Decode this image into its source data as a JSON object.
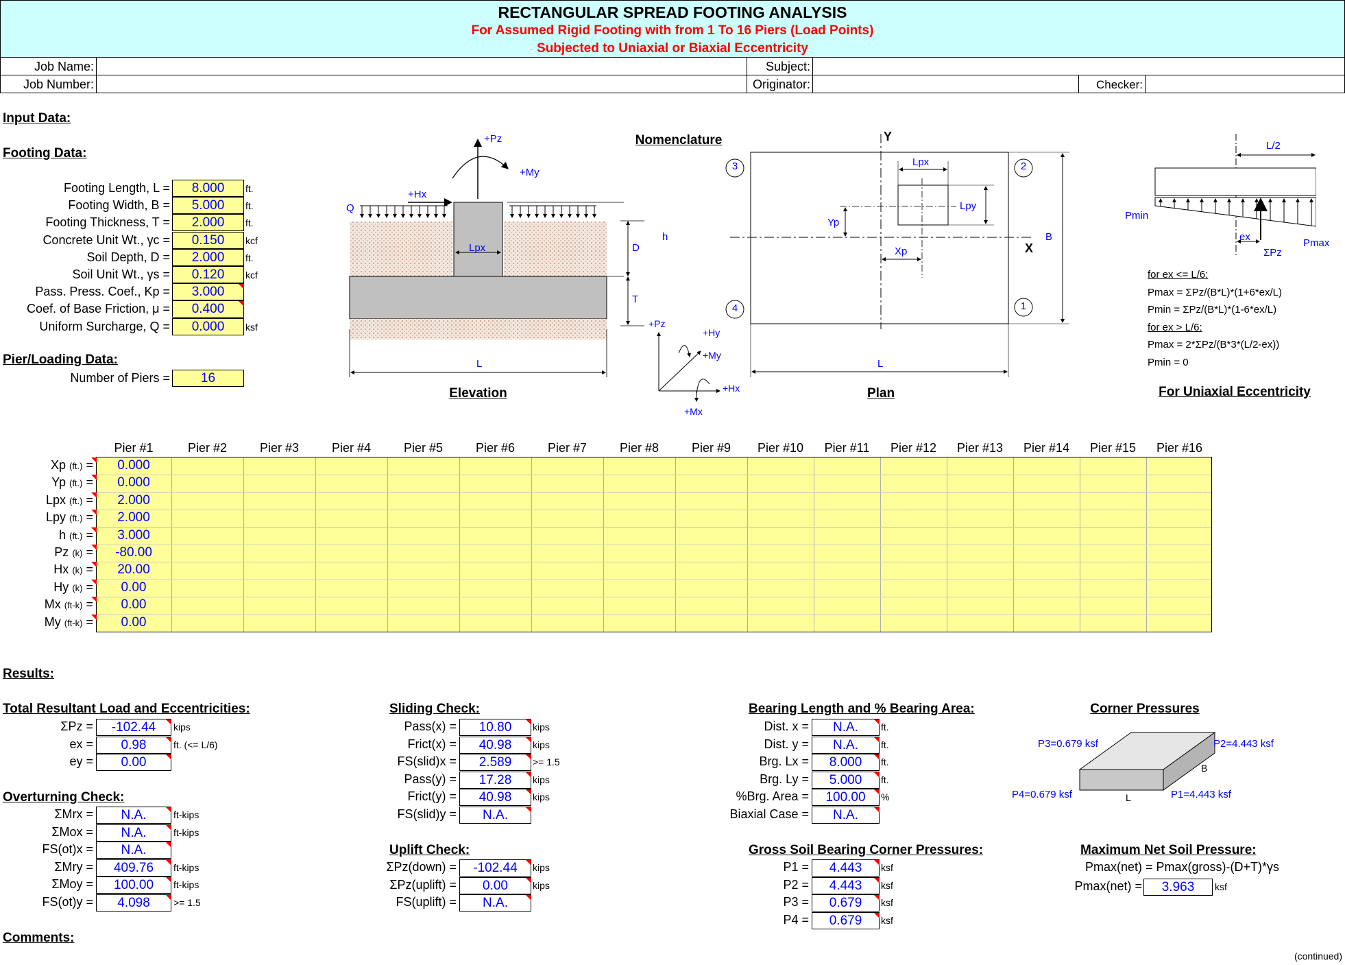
{
  "header": {
    "title": "RECTANGULAR SPREAD FOOTING ANALYSIS",
    "subtitle1": "For Assumed Rigid Footing with from 1 To 16 Piers (Load Points)",
    "subtitle2": "Subjected to Uniaxial or Biaxial Eccentricity"
  },
  "job": {
    "job_name_label": "Job Name:",
    "job_number_label": "Job Number:",
    "subject_label": "Subject:",
    "originator_label": "Originator:",
    "checker_label": "Checker:"
  },
  "input": {
    "section": "Input Data:",
    "footing_section": "Footing Data:",
    "footing": [
      {
        "label": "Footing Length, L =",
        "value": "8.000",
        "unit": "ft."
      },
      {
        "label": "Footing Width, B =",
        "value": "5.000",
        "unit": "ft."
      },
      {
        "label": "Footing Thickness, T =",
        "value": "2.000",
        "unit": "ft."
      },
      {
        "label": "Concrete Unit Wt., γc =",
        "value": "0.150",
        "unit": "kcf"
      },
      {
        "label": "Soil Depth, D =",
        "value": "2.000",
        "unit": "ft."
      },
      {
        "label": "Soil Unit Wt., γs =",
        "value": "0.120",
        "unit": "kcf"
      },
      {
        "label": "Pass. Press. Coef., Kp =",
        "value": "3.000",
        "unit": ""
      },
      {
        "label": "Coef. of Base Friction, μ =",
        "value": "0.400",
        "unit": ""
      },
      {
        "label": "Uniform Surcharge, Q =",
        "value": "0.000",
        "unit": "ksf"
      }
    ],
    "pier_section": "Pier/Loading Data:",
    "num_piers_label": "Number of Piers =",
    "num_piers": "16"
  },
  "diagrams": {
    "nomenclature": "Nomenclature",
    "elevation": "Elevation",
    "plan": "Plan",
    "uniaxial": "For Uniaxial Eccentricity",
    "elev_labels": {
      "pz": "+Pz",
      "my": "+My",
      "hx": "+Hx",
      "q": "Q",
      "lpx": "Lpx",
      "d": "D",
      "h": "h",
      "t": "T",
      "l": "L"
    },
    "axes_labels": {
      "pz": "+Pz",
      "hy": "+Hy",
      "my": "+My",
      "hx": "+Hx",
      "mx": "+Mx"
    },
    "plan_labels": {
      "y": "Y",
      "x": "X",
      "lpx": "Lpx",
      "lpy": "Lpy",
      "yp": "Yp",
      "xp": "Xp",
      "b": "B",
      "l": "L",
      "c1": "1",
      "c2": "2",
      "c3": "3",
      "c4": "4"
    },
    "ecc_labels": {
      "l2": "L/2",
      "pmin": "Pmin",
      "pmax": "Pmax",
      "ex": "ex",
      "spz": "ΣPz"
    },
    "formulas": [
      "for ex <= L/6:",
      "Pmax = ΣPz/(B*L)*(1+6*ex/L)",
      "Pmin = ΣPz/(B*L)*(1-6*ex/L)",
      "for ex > L/6:",
      "Pmax = 2*ΣPz/(B*3*(L/2-ex))",
      "Pmin = 0"
    ]
  },
  "piers": {
    "headers": [
      "Pier #1",
      "Pier #2",
      "Pier #3",
      "Pier #4",
      "Pier #5",
      "Pier #6",
      "Pier #7",
      "Pier #8",
      "Pier #9",
      "Pier #10",
      "Pier #11",
      "Pier #12",
      "Pier #13",
      "Pier #14",
      "Pier #15",
      "Pier #16"
    ],
    "rows": [
      {
        "label": "Xp",
        "unit": "(ft.)",
        "value": "0.000"
      },
      {
        "label": "Yp",
        "unit": "(ft.)",
        "value": "0.000"
      },
      {
        "label": "Lpx",
        "unit": "(ft.)",
        "value": "2.000"
      },
      {
        "label": "Lpy",
        "unit": "(ft.)",
        "value": "2.000"
      },
      {
        "label": "h",
        "unit": "(ft.)",
        "value": "3.000"
      },
      {
        "label": "Pz",
        "unit": "(k)",
        "value": "-80.00"
      },
      {
        "label": "Hx",
        "unit": "(k)",
        "value": "20.00"
      },
      {
        "label": "Hy",
        "unit": "(k)",
        "value": "0.00"
      },
      {
        "label": "Mx",
        "unit": "(ft-k)",
        "value": "0.00"
      },
      {
        "label": "My",
        "unit": "(ft-k)",
        "value": "0.00"
      }
    ]
  },
  "results": {
    "section": "Results:",
    "resultant": {
      "title": "Total Resultant Load and Eccentricities:",
      "rows": [
        {
          "label": "ΣPz =",
          "value": "-102.44",
          "unit": "kips"
        },
        {
          "label": "ex =",
          "value": "0.98",
          "unit": "ft. (<= L/6)"
        },
        {
          "label": "ey =",
          "value": "0.00",
          "unit": ""
        }
      ]
    },
    "overturning": {
      "title": "Overturning Check:",
      "rows": [
        {
          "label": "ΣMrx =",
          "value": "N.A.",
          "unit": "ft-kips"
        },
        {
          "label": "ΣMox =",
          "value": "N.A.",
          "unit": "ft-kips"
        },
        {
          "label": "FS(ot)x =",
          "value": "N.A.",
          "unit": ""
        },
        {
          "label": "ΣMry =",
          "value": "409.76",
          "unit": "ft-kips"
        },
        {
          "label": "ΣMoy =",
          "value": "100.00",
          "unit": "ft-kips"
        },
        {
          "label": "FS(ot)y =",
          "value": "4.098",
          "unit": ">= 1.5"
        }
      ]
    },
    "sliding": {
      "title": "Sliding Check:",
      "rows": [
        {
          "label": "Pass(x) =",
          "value": "10.80",
          "unit": "kips"
        },
        {
          "label": "Frict(x) =",
          "value": "40.98",
          "unit": "kips"
        },
        {
          "label": "FS(slid)x =",
          "value": "2.589",
          "unit": ">= 1.5"
        },
        {
          "label": "Pass(y) =",
          "value": "17.28",
          "unit": "kips"
        },
        {
          "label": "Frict(y) =",
          "value": "40.98",
          "unit": "kips"
        },
        {
          "label": "FS(slid)y =",
          "value": "N.A.",
          "unit": ""
        }
      ]
    },
    "uplift": {
      "title": "Uplift Check:",
      "rows": [
        {
          "label": "ΣPz(down) =",
          "value": "-102.44",
          "unit": "kips"
        },
        {
          "label": "ΣPz(uplift) =",
          "value": "0.00",
          "unit": "kips"
        },
        {
          "label": "FS(uplift) =",
          "value": "N.A.",
          "unit": ""
        }
      ]
    },
    "bearing": {
      "title": "Bearing Length and % Bearing Area:",
      "rows": [
        {
          "label": "Dist. x =",
          "value": "N.A.",
          "unit": "ft."
        },
        {
          "label": "Dist. y =",
          "value": "N.A.",
          "unit": "ft."
        },
        {
          "label": "Brg. Lx =",
          "value": "8.000",
          "unit": "ft."
        },
        {
          "label": "Brg. Ly =",
          "value": "5.000",
          "unit": "ft."
        },
        {
          "label": "%Brg. Area =",
          "value": "100.00",
          "unit": "%"
        },
        {
          "label": "Biaxial Case =",
          "value": "N.A.",
          "unit": ""
        }
      ]
    },
    "gross": {
      "title": "Gross Soil Bearing Corner Pressures:",
      "rows": [
        {
          "label": "P1 =",
          "value": "4.443",
          "unit": "ksf"
        },
        {
          "label": "P2 =",
          "value": "4.443",
          "unit": "ksf"
        },
        {
          "label": "P3 =",
          "value": "0.679",
          "unit": "ksf"
        },
        {
          "label": "P4 =",
          "value": "0.679",
          "unit": "ksf"
        }
      ]
    },
    "corner": {
      "title": "Corner Pressures",
      "p1": "P1=4.443 ksf",
      "p2": "P2=4.443 ksf",
      "p3": "P3=0.679 ksf",
      "p4": "P4=0.679 ksf",
      "l": "L",
      "b": "B"
    },
    "net": {
      "title": "Maximum Net Soil Pressure:",
      "formula": "Pmax(net) = Pmax(gross)-(D+T)*γs",
      "label": "Pmax(net) =",
      "value": "3.963",
      "unit": "ksf"
    }
  },
  "comments_label": "Comments:",
  "continued": "(continued)"
}
